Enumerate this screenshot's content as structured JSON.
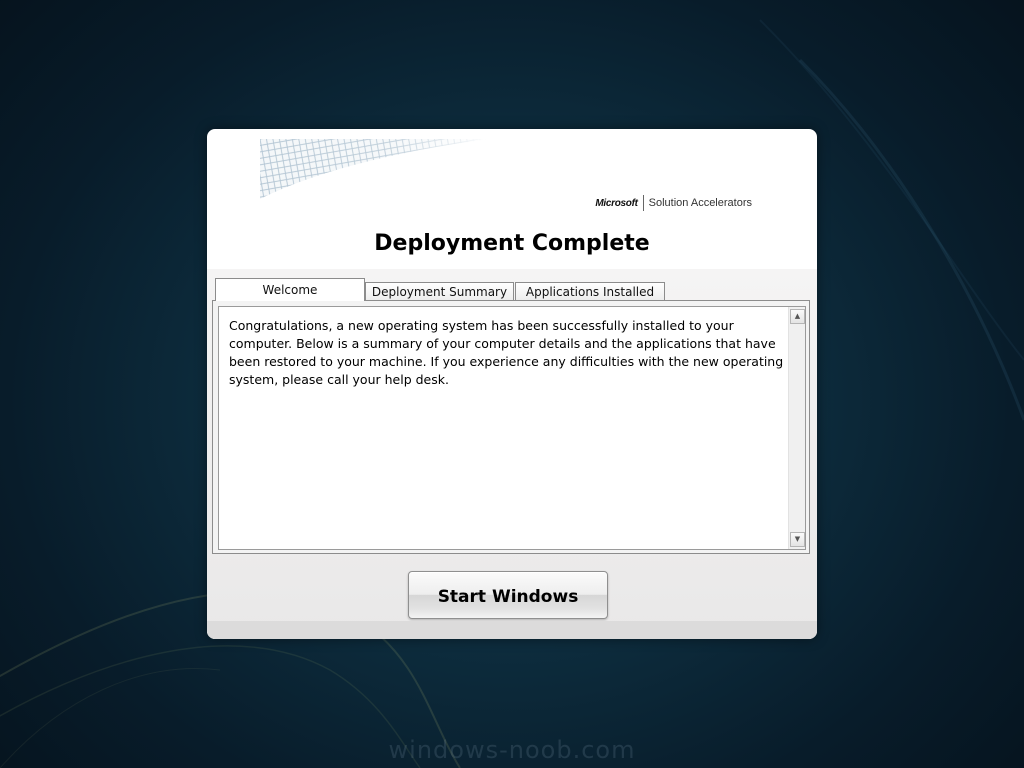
{
  "desktop": {
    "watermark": "windows-noob.com"
  },
  "dialog": {
    "brand": {
      "company": "Microsoft",
      "product": "Solution Accelerators"
    },
    "title": "Deployment Complete",
    "tabs": [
      {
        "label": "Welcome",
        "active": true
      },
      {
        "label": "Deployment Summary",
        "active": false
      },
      {
        "label": "Applications Installed",
        "active": false
      }
    ],
    "welcome_text": "Congratulations, a new operating system has been successfully installed to your computer.  Below is a summary of your computer details and the applications that have been restored to your machine.  If you experience any difficulties with the new operating system, please call your help desk.",
    "start_button_label": "Start Windows"
  },
  "colors": {
    "desktop_background": "#0d2c3d",
    "dialog_background": "#ffffff",
    "dialog_footer": "#e9e8e8",
    "banner_mesh": "#9fb7c9"
  },
  "icons": {
    "scroll_up": "scroll-up-arrow-icon",
    "scroll_down": "scroll-down-arrow-icon"
  }
}
